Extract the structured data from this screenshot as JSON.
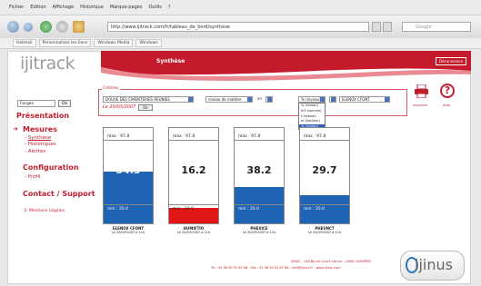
{
  "browser": {
    "menu": [
      "Fichier",
      "Edition",
      "Affichage",
      "Historique",
      "Marque-pages",
      "Outils",
      "?"
    ],
    "address": "http://www.ijitrack.com/fr/tableau_de_bord/synthese",
    "search_placeholder": "Google",
    "bookmarks": [
      "Hotmail",
      "Personnaliser les liens",
      "Windows Media",
      "Windows"
    ]
  },
  "header": {
    "logo": "ijitrack",
    "title": "Synthèse",
    "disconnect": "Déconnexion"
  },
  "sidebar": {
    "site_select": "Forges",
    "ok": "Ok",
    "presentation": "Présentation",
    "mesures": "Mesures",
    "mesures_items": [
      "Synthèse",
      "Historiques",
      "Alertes"
    ],
    "configuration": "Configuration",
    "configuration_items": [
      "Profil"
    ],
    "contact": "Contact / Support",
    "legal": "Mentions Légales"
  },
  "criteria": {
    "label": "Critères",
    "site": "DOUVE DES CIMENTERIES REUNIES",
    "measure": "niveau de matière",
    "en": "en",
    "unit": "% (niveau)",
    "silo": "ELENOX CFONT",
    "date": "Le 20/03/2007",
    "ok": "Ok",
    "dropdown": [
      "% (niveau)",
      "m3 (volume)",
      "t (masse)",
      "m (hauteur)",
      "% (niveau)"
    ],
    "dropdown_selected": 4
  },
  "tools": {
    "print": "Imprimer",
    "help": "Aide"
  },
  "gauges": [
    {
      "name": "ELENOX CFONT",
      "date": "Le 20/03/2007 à 11h",
      "value": "54.3",
      "max": "max : 97.8",
      "min": "min : 20.0",
      "level": 0.543,
      "color": "#1f64b4"
    },
    {
      "name": "HUMIFTIO",
      "date": "Le 20/03/2007 à 11h",
      "value": "16.2",
      "max": "max : 97.8",
      "min": "min : 20.0",
      "level": 0.162,
      "color": "#e21616"
    },
    {
      "name": "PHEXICE",
      "date": "Le 20/03/2007 à 11h",
      "value": "38.2",
      "max": "max : 97.8",
      "min": "min : 20.0",
      "level": 0.382,
      "color": "#1f64b4"
    },
    {
      "name": "PHEUNCT",
      "date": "Le 20/03/2007 à 11h",
      "value": "29.7",
      "max": "max : 97.8",
      "min": "min : 20.0",
      "level": 0.297,
      "color": "#1f64b4"
    }
  ],
  "footer": {
    "line1": "IJINUS - 148 Bd du Couch Vanne - 29000 QUIMPER",
    "line2": "Tel : 02 98 90 92 87 66 - Fax : 02 98 90 92 87 66 - info@ijinus.fr - www.ijinus.com",
    "brand": "ijinus"
  }
}
